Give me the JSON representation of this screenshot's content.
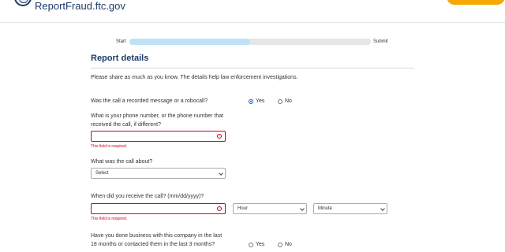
{
  "header": {
    "site_title": "ReportFraud.ftc.gov",
    "seal_icon": "ftc-seal-icon",
    "accent": "#f5a800",
    "brand": "#1f3a68"
  },
  "progress": {
    "start_label": "Start",
    "end_label": "Submit",
    "value": 0.5
  },
  "form": {
    "heading": "Report details",
    "intro": "Please share as much as you know. The details help law enforcement investigations.",
    "q_recorded": "Was the call a recorded message or a robocall?",
    "q_recorded_yes": "Yes",
    "q_recorded_no": "No",
    "q_recorded_selected": "Yes",
    "q_phone": "What is your phone number, or the phone number that received the call, if different?",
    "phone_value": "",
    "phone_error": "This field is required.",
    "q_about": "What was the call about?",
    "about_selected": "Select",
    "q_when": "When did you receive the call? (mm/dd/yyyy)?",
    "date_value": "",
    "date_error": "This field is required.",
    "hour_selected": "Hour",
    "minute_selected": "Minute",
    "q_business": "Have you done business with this company in the last 18 months or contacted them in the last 3 months?",
    "q_business_yes": "Yes",
    "q_business_no": "No",
    "error_color": "#d6001c"
  }
}
